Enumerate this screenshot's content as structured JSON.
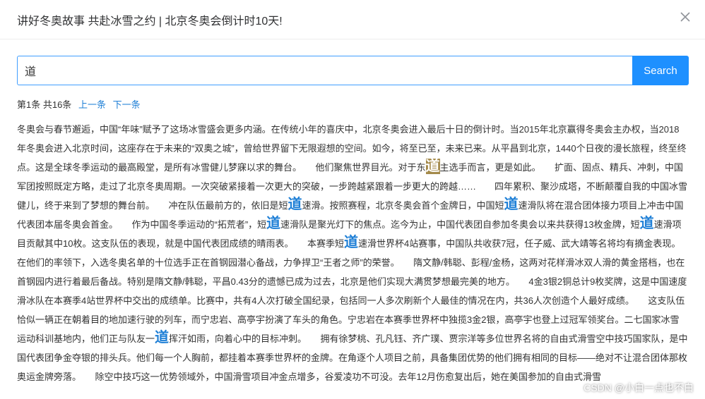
{
  "dialog": {
    "title": "讲好冬奥故事 共赴冰雪之约 | 北京冬奥会倒计时10天!"
  },
  "search": {
    "value": "道",
    "button_label": "Search"
  },
  "pager": {
    "status": "第1条 共16条",
    "prev_label": "上一条",
    "next_label": "下一条"
  },
  "article": {
    "keyword": "道",
    "segments": [
      {
        "t": "冬奥会与春节邂逅，中国“年味”赋予了这场冰雪盛会更多内涵。在传统小年的喜庆中，北京冬奥会进入最后十日的倒计时。当2015年北京赢得冬奥会主办权，当2018年冬奥会进入北京时间，这座存在于未来的“双奥之城”，曾给世界留下无限遐想的空间。如今，将至已至，未来已来。从平昌到北京，1440个日夜的漫长旅程，终至终点。这是全球冬季运动的最高殿堂，是所有冰雪健儿梦寐以求的舞台。　　他们聚焦世界目光。对于东"
      },
      {
        "k": "道",
        "current": true
      },
      {
        "t": "主选手而言，更是如此。　　扩面、固点、精兵、冲刺，中国军团按照既定方略，走过了北京冬奥周期。一次突破紧接着一次更大的突破，一步跨越紧跟着一步更大的跨越……　　四年累积、聚沙成塔，不断颠覆自我的中国冰雪健儿，终于来到了梦想的舞台前。　　冲在队伍最前方的，依旧是短"
      },
      {
        "k": "道"
      },
      {
        "t": "速滑。按照赛程，北京冬奥会首个金牌日，中国短"
      },
      {
        "k": "道"
      },
      {
        "t": "速滑队将在混合团体接力项目上冲击中国代表团本届冬奥会首金。　　作为中国冬季运动的“拓荒者”，短"
      },
      {
        "k": "道"
      },
      {
        "t": "速滑队是聚光灯下的焦点。迄今为止，中国代表团自参加冬奥会以来共获得13枚金牌，短"
      },
      {
        "k": "道"
      },
      {
        "t": "速滑项目贡献其中10枚。这支队伍的表现，就是中国代表团成绩的晴雨表。　　本赛季短"
      },
      {
        "k": "道"
      },
      {
        "t": "速滑世界杯4站赛事，中国队共收获7冠，任子威、武大靖等名将均有摘金表现。在他们的率领下，入选冬奥名单的十位选手正在首钢园潜心备战，力争捍卫“王者之师”的荣誉。　　隋文静/韩聪、彭程/金杨，这两对花样滑冰双人滑的黄金搭档，也在首钢园内进行着最后备战。特别是隋文静/韩聪，平昌0.43分的遗憾已成为过去，北京是他们实现大满贯梦想最完美的地方。　　4金3银2铜总计9枚奖牌，这是中国速度滑冰队在本赛季4站世界杯中交出的成绩单。比赛中，共有4人次打破全国纪录，包括同一人多次刷新个人最佳的情况在内，共36人次创造个人最好成绩。　　这支队伍恰似一辆正在朝着目的地加速行驶的列车，而宁忠岩、高亭宇扮演了车头的角色。宁忠岩在本赛季世界杯中独揽3金2银，高亭宇也登上过冠军领奖台。二七国家冰雪运动科训基地内，他们正与队友一"
      },
      {
        "k": "道"
      },
      {
        "t": "挥汗如雨，向着心中的目标冲刺。　　拥有徐梦桃、孔凡钰、齐广璞、贾宗洋等多位世界名将的自由式滑雪空中技巧国家队，是中国代表团争金夺银的排头兵。他们每一个人胸前，都挂着本赛季世界杯的金牌。在角逐个人项目之前，具备集团优势的他们拥有相同的目标——绝对不让混合团体那枚奥运金牌旁落。　　除空中技巧这一优势领域外，中国滑雪项目冲金点增多，谷爱凌功不可没。去年12月伤愈复出后，她在美国参加的自由式滑雪"
      }
    ]
  },
  "watermark": "CSDN @小白一点也不白"
}
